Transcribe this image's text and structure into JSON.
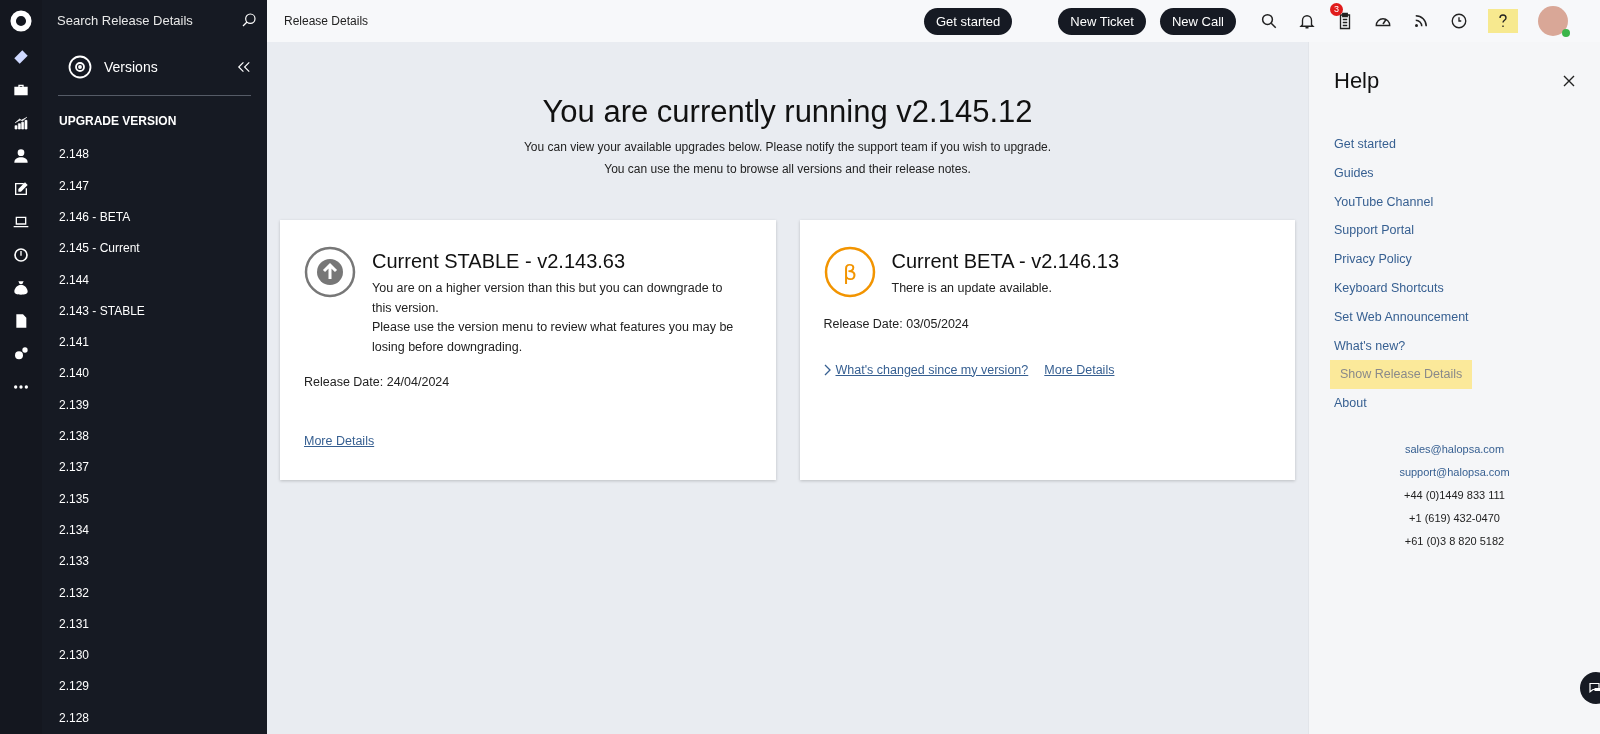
{
  "sidebar": {
    "search": {
      "placeholder": "Search Release Details"
    },
    "title": "Versions",
    "section_title": "UPGRADE VERSION",
    "items": [
      {
        "label": "2.148"
      },
      {
        "label": "2.147"
      },
      {
        "label": "2.146 - BETA"
      },
      {
        "label": "2.145 - Current"
      },
      {
        "label": "2.144"
      },
      {
        "label": "2.143 - STABLE"
      },
      {
        "label": "2.141"
      },
      {
        "label": "2.140"
      },
      {
        "label": "2.139"
      },
      {
        "label": "2.138"
      },
      {
        "label": "2.137"
      },
      {
        "label": "2.135"
      },
      {
        "label": "2.134"
      },
      {
        "label": "2.133"
      },
      {
        "label": "2.132"
      },
      {
        "label": "2.131"
      },
      {
        "label": "2.130"
      },
      {
        "label": "2.129"
      },
      {
        "label": "2.128"
      }
    ]
  },
  "topbar": {
    "breadcrumb": "Release Details",
    "buttons": [
      "Get started",
      "New Ticket",
      "New Call"
    ],
    "notification_count": "3",
    "help_highlighted": true,
    "avatar_online": true
  },
  "main": {
    "heading": "You are currently running v2.145.12",
    "subtitle_lines": [
      "You can view your available upgrades below. Please notify the support team if you wish to upgrade.",
      "You can use the menu to browse all versions and their release notes."
    ],
    "cards": [
      {
        "kind": "stable",
        "title": "Current STABLE - v2.143.63",
        "description_lines": [
          "You are on a higher version than this but you can downgrade to this version.",
          "Please use the version menu to review what features you may be losing before downgrading."
        ],
        "release_date": "Release Date: 24/04/2024",
        "links": [
          "More Details"
        ]
      },
      {
        "kind": "beta",
        "icon_glyph": "β",
        "title": "Current BETA - v2.146.13",
        "description_lines": [
          "There is an update available."
        ],
        "release_date": "Release Date: 03/05/2024",
        "links": [
          "What's changed since my version?",
          "More Details"
        ]
      }
    ]
  },
  "help": {
    "title": "Help",
    "items": [
      {
        "label": "Get started",
        "highlighted": false
      },
      {
        "label": "Guides",
        "highlighted": false
      },
      {
        "label": "YouTube Channel",
        "highlighted": false
      },
      {
        "label": "Support Portal",
        "highlighted": false
      },
      {
        "label": "Privacy Policy",
        "highlighted": false
      },
      {
        "label": "Keyboard Shortcuts",
        "highlighted": false
      },
      {
        "label": "Set Web Announcement",
        "highlighted": false
      },
      {
        "label": "What's new?",
        "highlighted": false
      },
      {
        "label": "Show Release Details",
        "highlighted": true
      },
      {
        "label": "About",
        "highlighted": false
      }
    ],
    "emails": [
      "sales@halopsa.com",
      "support@halopsa.com"
    ],
    "phones": [
      "+44 (0)1449 833 111",
      "+1 (619) 432-0470",
      "+61 (0)3 8 820 5182"
    ]
  }
}
